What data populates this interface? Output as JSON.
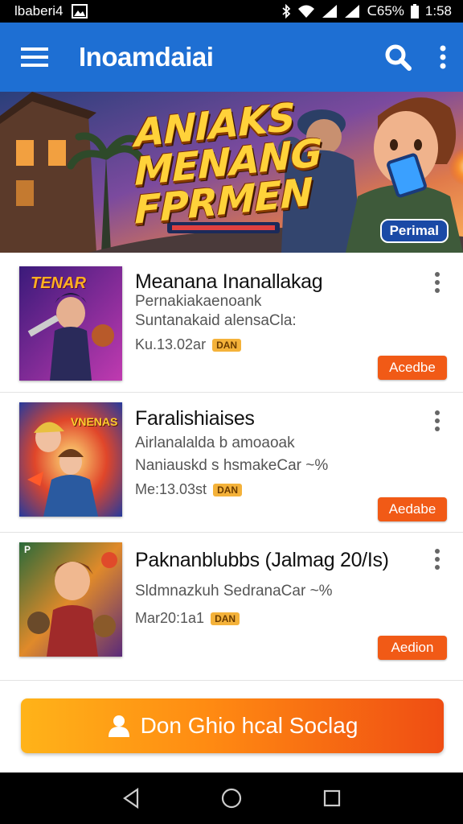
{
  "status_bar": {
    "carrier": "lbaberi4",
    "battery": "ᑕ65%",
    "time": "1:58"
  },
  "app_bar": {
    "title": "Inoamdaiai",
    "icons": [
      "menu-icon",
      "search-icon",
      "more-vert-icon"
    ]
  },
  "banner": {
    "headline_line1": "ANIAKS",
    "headline_line2": "MENANG",
    "headline_line3": "FPRMEN",
    "badge": "Perimal"
  },
  "items": [
    {
      "title": "Meanana Inanallakag",
      "subtitle1": "Pernakiakaenoank",
      "subtitle2": "Suntanakaid alensaCla:",
      "meta": "Ku.13.02ar",
      "badge": "DAN",
      "action": "Acedbe",
      "thumb_label": "TENAR"
    },
    {
      "title": "Faralishiaises",
      "subtitle1": "Airlanalalda b amoaoak",
      "subtitle2": "Naniauskd s hsmakeCar ~%",
      "meta": "Me:13.03st",
      "badge": "DAN",
      "action": "Aedabe",
      "thumb_label": "VNENAS"
    },
    {
      "title": "Paknanblubbs (Jalmag 20/Is)",
      "subtitle1": "",
      "subtitle2": "Sldmnazkuh SedranaCar ~%",
      "meta": "Mar20:1a1",
      "badge": "DAN",
      "action": "Aedion",
      "thumb_label": "P"
    }
  ],
  "cta": {
    "label": "Don Ghio hcal Soclag"
  },
  "colors": {
    "app_bar": "#1e6fd3",
    "accent_orange": "#f15a16",
    "cta_start": "#ffb319",
    "cta_end": "#ef4d13"
  }
}
